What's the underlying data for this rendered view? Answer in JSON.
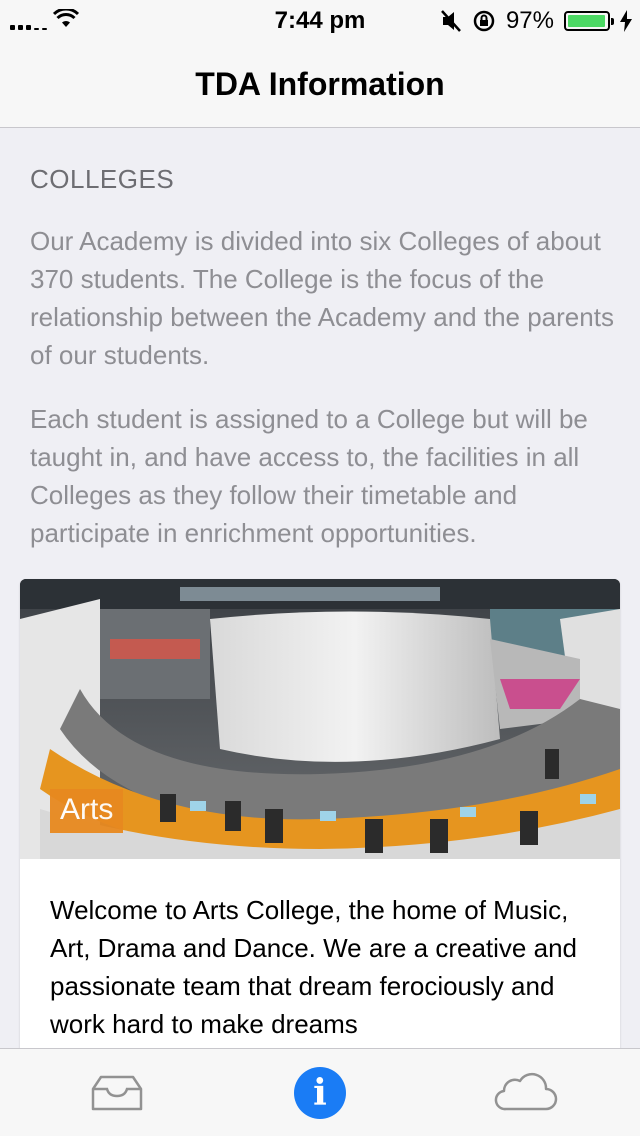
{
  "status_bar": {
    "time": "7:44 pm",
    "battery_percent": "97%",
    "battery_level": 0.97,
    "icons": [
      "signal-icon",
      "wifi-icon",
      "mute-icon",
      "rotation-lock-icon",
      "battery-icon",
      "charging-icon"
    ]
  },
  "nav": {
    "title": "TDA Information"
  },
  "content": {
    "section_header": "COLLEGES",
    "paragraph_1": "Our Academy is divided into six Colleges of about 370 students. The College is the focus of the relationship between the Academy and the parents of our students.",
    "paragraph_2": "Each student is assigned to a College but will be taught in, and have access to, the facilities in all Colleges as they follow their timetable and participate in enrichment opportunities."
  },
  "card": {
    "badge": "Arts",
    "text": "Welcome to Arts College, the home of Music, Art, Drama and Dance. We are a creative and passionate team that dream ferociously and work hard to make dreams"
  },
  "tab_bar": {
    "items": [
      {
        "icon": "inbox-icon",
        "selected": false
      },
      {
        "icon": "info-icon",
        "selected": true
      },
      {
        "icon": "cloud-icon",
        "selected": false
      }
    ],
    "info_glyph": "i",
    "active_color": "#1a7cf5"
  },
  "colors": {
    "background": "#efeff4",
    "badge": "#e8891f",
    "secondary_text": "#8e8e93"
  }
}
